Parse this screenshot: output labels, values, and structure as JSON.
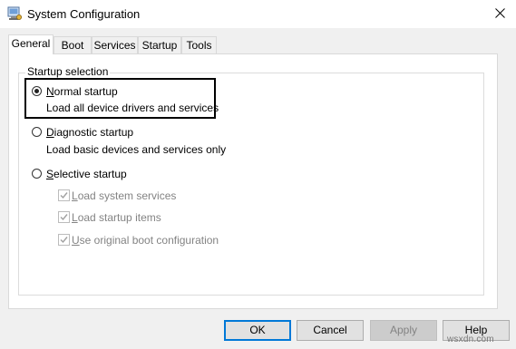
{
  "window": {
    "title": "System Configuration",
    "icon": "system-config-icon",
    "close_icon": "close-icon"
  },
  "tabs": [
    {
      "label": "General",
      "active": true
    },
    {
      "label": "Boot"
    },
    {
      "label": "Services"
    },
    {
      "label": "Startup"
    },
    {
      "label": "Tools"
    }
  ],
  "startup_selection": {
    "group_label": "Startup selection",
    "normal": {
      "prefix": "",
      "mnemonic": "N",
      "rest": "ormal startup",
      "description": "Load all device drivers and services",
      "selected": true
    },
    "diagnostic": {
      "mnemonic": "D",
      "rest": "iagnostic startup",
      "description": "Load basic devices and services only",
      "selected": false
    },
    "selective": {
      "mnemonic": "S",
      "rest": "elective startup",
      "selected": false,
      "options": [
        {
          "mnemonic": "L",
          "rest": "oad system services",
          "checked": true,
          "enabled": false
        },
        {
          "mnemonic": "L",
          "rest": "oad startup items",
          "checked": true,
          "enabled": false
        },
        {
          "mnemonic": "U",
          "rest": "se original boot configuration",
          "checked": true,
          "enabled": false
        }
      ]
    }
  },
  "buttons": {
    "ok": "OK",
    "cancel": "Cancel",
    "apply": "Apply",
    "help": "Help"
  },
  "watermark": "wsxdn.com"
}
